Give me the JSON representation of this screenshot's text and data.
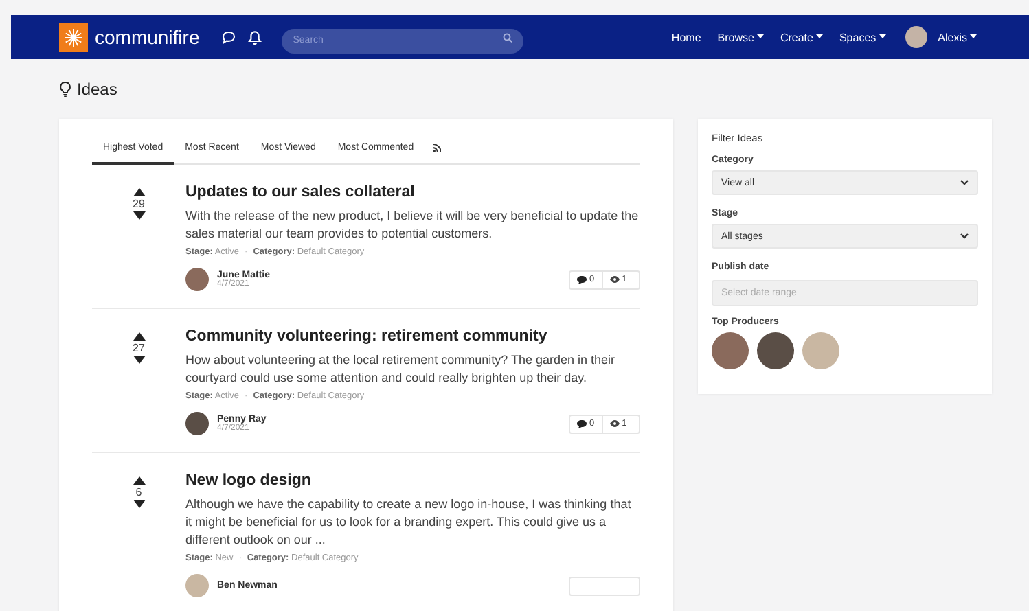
{
  "nav": {
    "logo": "communifire",
    "search": {
      "placeholder": "Search"
    },
    "links": [
      {
        "label": "Home",
        "dropdown": false
      },
      {
        "label": "Browse",
        "dropdown": true
      },
      {
        "label": "Create",
        "dropdown": true
      },
      {
        "label": "Spaces",
        "dropdown": true
      }
    ],
    "user": {
      "name": "Alexis",
      "dropdown": true
    }
  },
  "page_title": "Ideas",
  "tabs": [
    {
      "label": "Highest Voted",
      "selected": true
    },
    {
      "label": "Most Recent",
      "selected": false
    },
    {
      "label": "Most Viewed",
      "selected": false
    },
    {
      "label": "Most Commented",
      "selected": false
    }
  ],
  "ideas": [
    {
      "votes": "29",
      "title": "Updates to our sales collateral",
      "body": "With the release of the new product, I believe it will be very beneficial to update the sales material our team provides to potential customers.",
      "meta": [
        {
          "label": "Stage:",
          "value": "Active"
        },
        {
          "label": "Category:",
          "value": "Default Category"
        }
      ],
      "separator": "·",
      "author": "June Mattie",
      "date": "4/7/2021",
      "comments": "0",
      "views": "1"
    },
    {
      "votes": "27",
      "title": "Community volunteering: retirement community",
      "body": "How about volunteering at the local retirement community? The garden in their courtyard could use some attention and could really brighten up their day.",
      "meta": [
        {
          "label": "Stage:",
          "value": "Active"
        },
        {
          "label": "Category:",
          "value": "Default Category"
        }
      ],
      "separator": "·",
      "author": "Penny Ray",
      "date": "4/7/2021",
      "comments": "0",
      "views": "1"
    },
    {
      "votes": "6",
      "title": "New logo design",
      "body": "Although we have the capability to create a new logo in-house, I was thinking that it might be beneficial for us to look for a branding expert. This could give us a different outlook on our ...",
      "meta": [
        {
          "label": "Stage:",
          "value": "New"
        },
        {
          "label": "Category:",
          "value": "Default Category"
        }
      ],
      "separator": "·",
      "author": "Ben Newman"
    }
  ],
  "filter": {
    "title": "Filter Ideas",
    "fields": [
      {
        "kind": "select",
        "label": "Category",
        "value": "View all"
      },
      {
        "kind": "select",
        "label": "Stage",
        "value": "All stages"
      },
      {
        "kind": "input",
        "label": "Publish date",
        "placeholder": "Select date range"
      }
    ],
    "producers_title": "Top Producers"
  }
}
